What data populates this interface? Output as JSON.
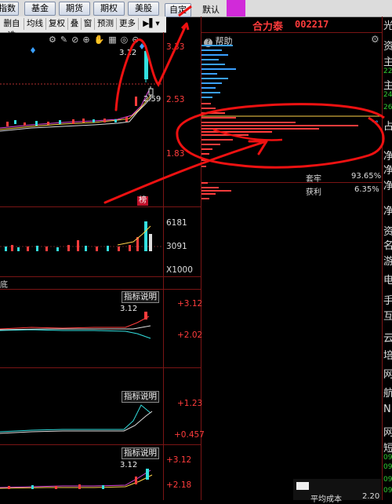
{
  "tabs": {
    "items": [
      "指数",
      "基金",
      "期货",
      "期权",
      "美股"
    ],
    "extra1": "自定",
    "extra2": "默认"
  },
  "toolbar": {
    "items": [
      "删自选",
      "均线",
      "复权",
      "叠",
      "窗",
      "预测",
      "更多"
    ]
  },
  "stock": {
    "name": "合力泰",
    "code": "002217"
  },
  "main_chart": {
    "price_high_label": "3.12",
    "price_low_label": "2.59",
    "axis": [
      "3.33",
      "2.53",
      "1.83"
    ],
    "badge": "榜"
  },
  "help_label": "帮助",
  "chip_stats": {
    "trapped_label": "套牢",
    "trapped_value": "93.65%",
    "profit_label": "获利",
    "profit_value": "6.35%"
  },
  "volume": {
    "axis": [
      "6181",
      "3091",
      "X1000"
    ],
    "bottom_label": "底"
  },
  "indicator_panels": [
    {
      "button": "指标说明",
      "value_label": "3.12",
      "axis": [
        "+3.12",
        "+2.02"
      ]
    },
    {
      "button": "指标说明",
      "value_label": "",
      "axis": [
        "+1.23",
        "+0.457"
      ]
    },
    {
      "button": "指标说明",
      "value_label": "3.12",
      "axis": [
        "+3.12",
        "+2.18"
      ]
    }
  ],
  "footer": {
    "avg_cost_label": "平均成本",
    "avg_cost_value": "2.20"
  },
  "right_column": [
    "光",
    "资",
    "主",
    "22",
    "主",
    "24",
    "26",
    "占",
    "净",
    "净",
    "净",
    "净",
    "资",
    "名",
    "游",
    "电",
    "手",
    "互",
    "云",
    "培",
    "网",
    "航",
    "NI",
    "网",
    "短",
    "09",
    "09",
    "09",
    "09"
  ],
  "colors": {
    "up": "#ff3c3c",
    "down": "#33e0e0",
    "chip_blue": "#3aa0ff",
    "chip_red": "#ff3c3c",
    "annotation": "#ee1111"
  }
}
